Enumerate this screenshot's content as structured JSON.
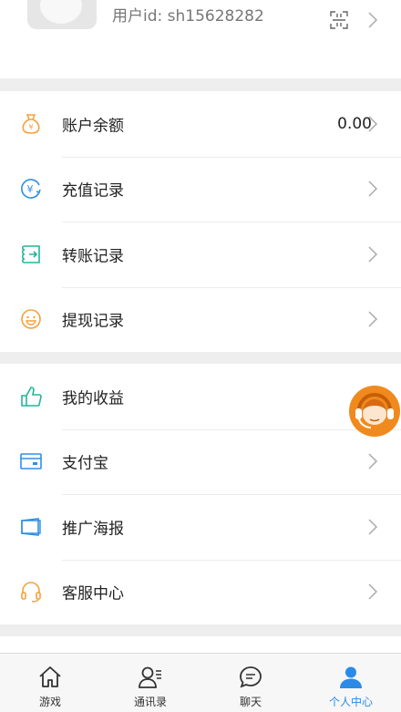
{
  "profile": {
    "user_id_text": "用户id: sh15628282",
    "qr_icon": "qr-code-icon",
    "chevron_icon": "chevron-right-icon"
  },
  "menu_groups": [
    {
      "items": [
        {
          "label": "账户余额",
          "value": "0.00",
          "icon": "money-bag-icon",
          "color": "#f5a23c"
        },
        {
          "label": "充值记录",
          "icon": "yen-recharge-icon",
          "color": "#2f8fe6"
        },
        {
          "label": "转账记录",
          "icon": "transfer-icon",
          "color": "#22b59a"
        },
        {
          "label": "提现记录",
          "icon": "smiley-icon",
          "color": "#f5a23c"
        }
      ]
    },
    {
      "items": [
        {
          "label": "我的收益",
          "icon": "thumbs-up-icon",
          "color": "#22b59a"
        },
        {
          "label": "支付宝",
          "icon": "card-icon",
          "color": "#2f8fe6"
        },
        {
          "label": "推广海报",
          "icon": "poster-icon",
          "color": "#2f8fe6"
        },
        {
          "label": "客服中心",
          "icon": "headset-icon",
          "color": "#f5a23c"
        }
      ]
    }
  ],
  "floating_button": {
    "icon": "customer-service-avatar-icon"
  },
  "tabbar": {
    "tabs": [
      {
        "label": "游戏",
        "icon": "home-icon"
      },
      {
        "label": "通讯录",
        "icon": "contacts-icon"
      },
      {
        "label": "聊天",
        "icon": "chat-icon"
      },
      {
        "label": "个人中心",
        "icon": "person-icon",
        "active": true
      }
    ],
    "active_color": "#2b8ae6"
  }
}
